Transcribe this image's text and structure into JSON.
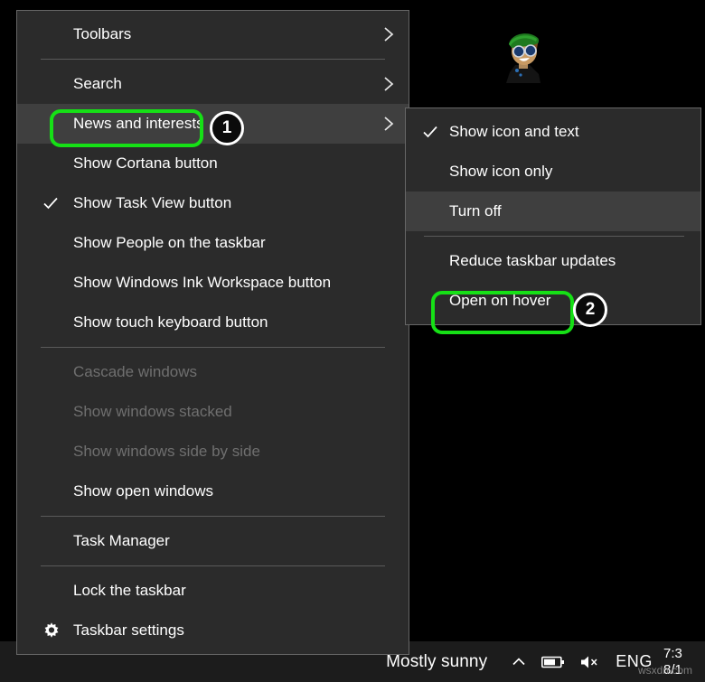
{
  "desktop": {
    "avatar_icon": "cartoon-avatar-icon"
  },
  "taskbar": {
    "weather_text": "Mostly sunny",
    "tray": {
      "show_hidden_icons_icon": "chevron-up-icon",
      "battery_icon": "battery-icon",
      "volume_icon": "speaker-mute-icon",
      "language": "ENG"
    },
    "clock": {
      "time": "7:3",
      "date": "8/1"
    },
    "watermark": "wsxdn.com"
  },
  "main_menu": {
    "name": "taskbar-context-menu",
    "items": [
      {
        "label": "Toolbars",
        "submenu": true,
        "checked": false,
        "disabled": false,
        "hovered": false,
        "icon": null,
        "separator_after": true
      },
      {
        "label": "Search",
        "submenu": true,
        "checked": false,
        "disabled": false,
        "hovered": false,
        "icon": null,
        "separator_after": false
      },
      {
        "label": "News and interests",
        "submenu": true,
        "checked": false,
        "disabled": false,
        "hovered": true,
        "icon": null,
        "separator_after": false
      },
      {
        "label": "Show Cortana button",
        "submenu": false,
        "checked": false,
        "disabled": false,
        "hovered": false,
        "icon": null,
        "separator_after": false
      },
      {
        "label": "Show Task View button",
        "submenu": false,
        "checked": true,
        "disabled": false,
        "hovered": false,
        "icon": null,
        "separator_after": false
      },
      {
        "label": "Show People on the taskbar",
        "submenu": false,
        "checked": false,
        "disabled": false,
        "hovered": false,
        "icon": null,
        "separator_after": false
      },
      {
        "label": "Show Windows Ink Workspace button",
        "submenu": false,
        "checked": false,
        "disabled": false,
        "hovered": false,
        "icon": null,
        "separator_after": false
      },
      {
        "label": "Show touch keyboard button",
        "submenu": false,
        "checked": false,
        "disabled": false,
        "hovered": false,
        "icon": null,
        "separator_after": true
      },
      {
        "label": "Cascade windows",
        "submenu": false,
        "checked": false,
        "disabled": true,
        "hovered": false,
        "icon": null,
        "separator_after": false
      },
      {
        "label": "Show windows stacked",
        "submenu": false,
        "checked": false,
        "disabled": true,
        "hovered": false,
        "icon": null,
        "separator_after": false
      },
      {
        "label": "Show windows side by side",
        "submenu": false,
        "checked": false,
        "disabled": true,
        "hovered": false,
        "icon": null,
        "separator_after": false
      },
      {
        "label": "Show open windows",
        "submenu": false,
        "checked": false,
        "disabled": false,
        "hovered": false,
        "icon": null,
        "separator_after": true
      },
      {
        "label": "Task Manager",
        "submenu": false,
        "checked": false,
        "disabled": false,
        "hovered": false,
        "icon": null,
        "separator_after": true
      },
      {
        "label": "Lock the taskbar",
        "submenu": false,
        "checked": false,
        "disabled": false,
        "hovered": false,
        "icon": null,
        "separator_after": false
      },
      {
        "label": "Taskbar settings",
        "submenu": false,
        "checked": false,
        "disabled": false,
        "hovered": false,
        "icon": "gear-icon",
        "separator_after": false
      }
    ]
  },
  "sub_menu": {
    "name": "news-and-interests-submenu",
    "items": [
      {
        "label": "Show icon and text",
        "checked": true,
        "hovered": false,
        "separator_after": false
      },
      {
        "label": "Show icon only",
        "checked": false,
        "hovered": false,
        "separator_after": false
      },
      {
        "label": "Turn off",
        "checked": false,
        "hovered": true,
        "separator_after": true
      },
      {
        "label": "Reduce taskbar updates",
        "checked": false,
        "hovered": false,
        "separator_after": false
      },
      {
        "label": "Open on hover",
        "checked": false,
        "hovered": false,
        "separator_after": false
      }
    ]
  },
  "callouts": {
    "highlight_color": "#16e016",
    "badges": [
      {
        "number": "1",
        "target": "News and interests"
      },
      {
        "number": "2",
        "target": "Open on hover"
      }
    ]
  }
}
